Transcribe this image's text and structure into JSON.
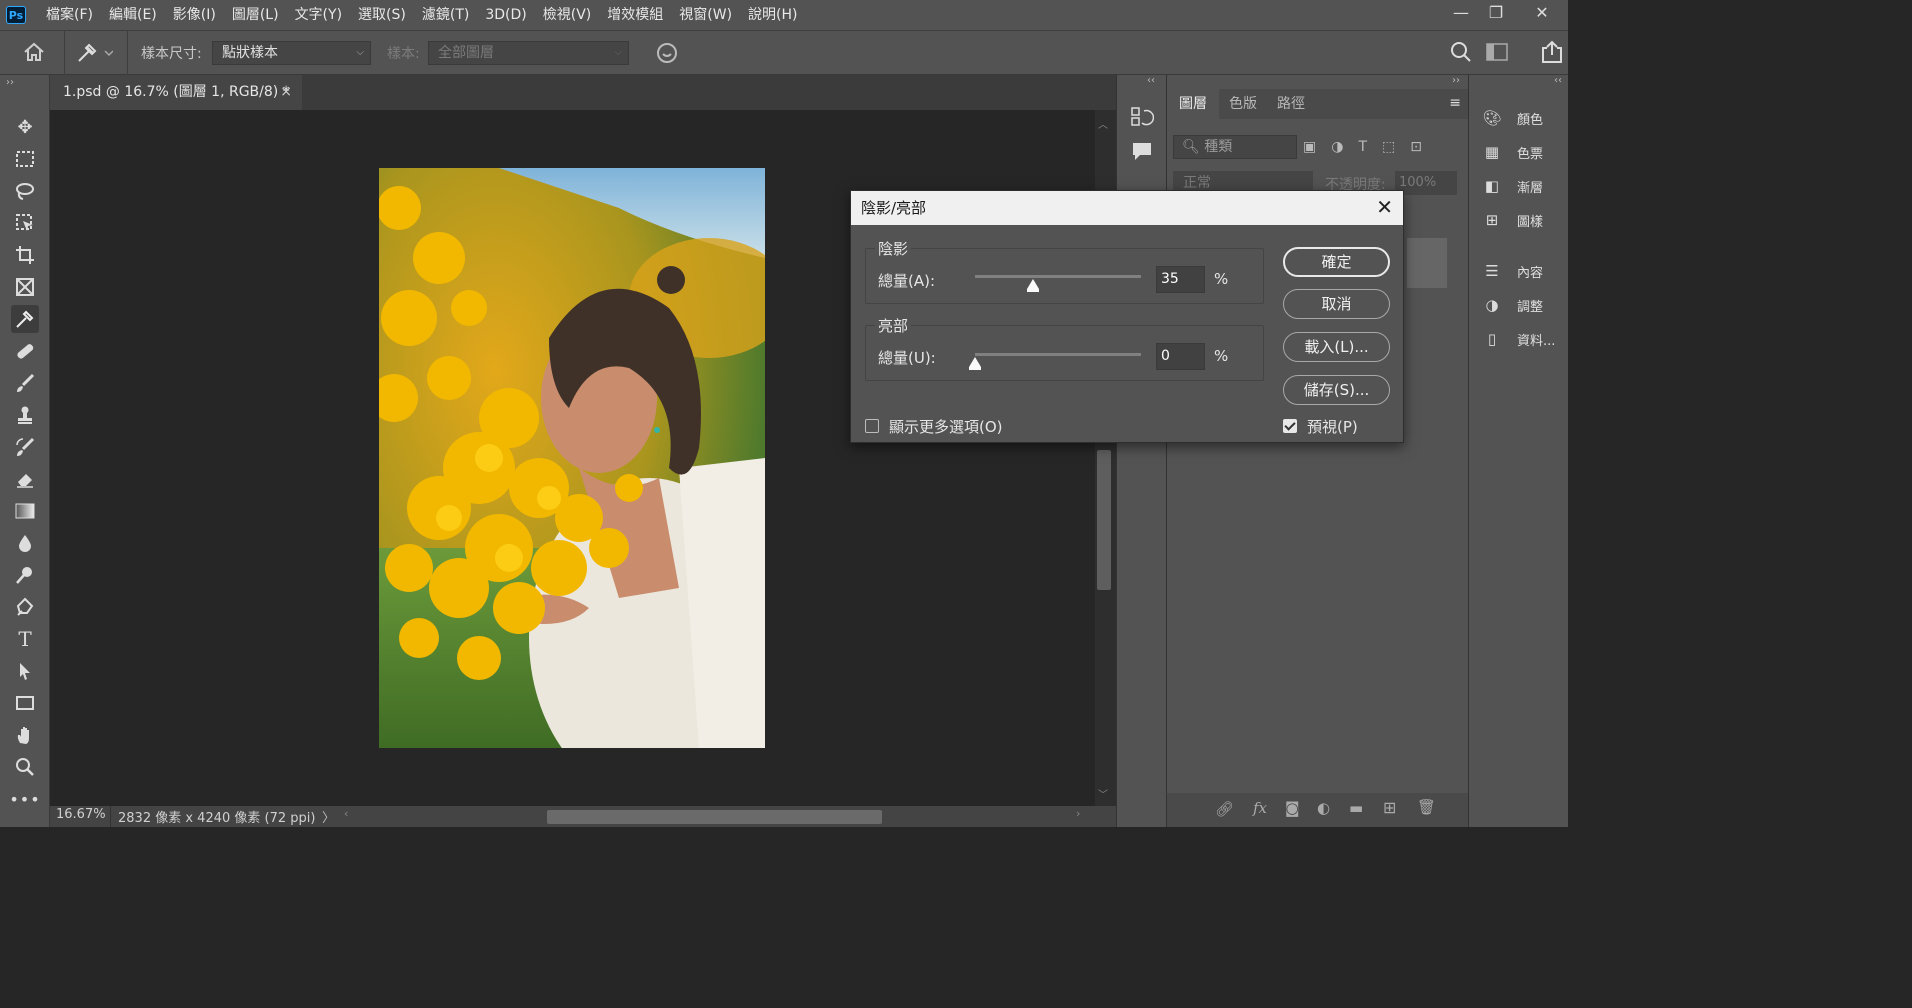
{
  "app": {
    "logo": "Ps"
  },
  "menu": [
    "檔案(F)",
    "編輯(E)",
    "影像(I)",
    "圖層(L)",
    "文字(Y)",
    "選取(S)",
    "濾鏡(T)",
    "3D(D)",
    "檢視(V)",
    "增效模組",
    "視窗(W)",
    "說明(H)"
  ],
  "window_controls": {
    "minimize": "—",
    "restore": "❐",
    "close": "✕"
  },
  "options": {
    "sample_size_label": "樣本尺寸:",
    "sample_size_value": "點狀樣本",
    "sample_label": "樣本:",
    "sample_value": "全部圖層"
  },
  "document": {
    "tab_title": "1.psd @ 16.7% (圖層 1, RGB/8) *",
    "close": "×"
  },
  "status": {
    "zoom": "16.67%",
    "info": "2832 像素 x 4240 像素 (72 ppi)"
  },
  "layers_panel": {
    "tabs": [
      "圖層",
      "色版",
      "路徑"
    ],
    "search_placeholder": "種類",
    "blend_mode": "正常",
    "opacity_label": "不透明度:",
    "opacity_value": "100%"
  },
  "right_dock": [
    {
      "label": "顏色",
      "icon": "palette-icon"
    },
    {
      "label": "色票",
      "icon": "swatches-icon"
    },
    {
      "label": "漸層",
      "icon": "gradient-icon"
    },
    {
      "label": "圖樣",
      "icon": "patterns-icon"
    },
    {
      "label": "內容",
      "icon": "properties-icon"
    },
    {
      "label": "調整",
      "icon": "adjustments-icon"
    },
    {
      "label": "資料...",
      "icon": "libraries-icon"
    }
  ],
  "dialog": {
    "title": "陰影/亮部",
    "shadows": {
      "group_title": "陰影",
      "amount_label": "總量(A):",
      "amount_value": "35",
      "unit": "%",
      "slider_fraction": 0.35
    },
    "highlights": {
      "group_title": "亮部",
      "amount_label": "總量(U):",
      "amount_value": "0",
      "unit": "%",
      "slider_fraction": 0.0
    },
    "more_options_label": "顯示更多選項(O)",
    "more_options_checked": false,
    "preview_label": "預視(P)",
    "preview_checked": true,
    "buttons": {
      "ok": "確定",
      "cancel": "取消",
      "load": "載入(L)...",
      "save": "儲存(S)..."
    }
  }
}
